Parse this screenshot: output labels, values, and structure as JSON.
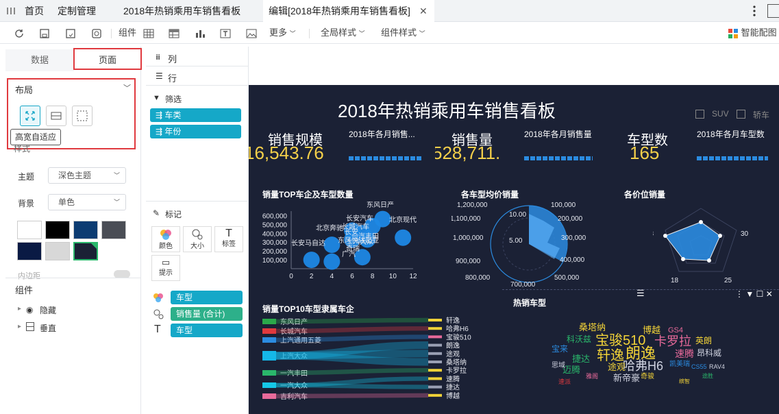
{
  "tabs": {
    "menu_icon": "grid-menu-icon",
    "home": "首页",
    "custom": "定制管理",
    "board": "2018年热销乘用车销售看板",
    "edit": "编辑[2018年热销乘用车销售看板]"
  },
  "toolbar": {
    "component": "组件",
    "more": "更多",
    "global_style": "全局样式",
    "component_style": "组件样式",
    "smart_chart": "智能配图"
  },
  "left": {
    "tab_data": "数据",
    "tab_page": "页面",
    "layout": "布局",
    "tooltip": "高宽自适应",
    "style": "样式",
    "theme_label": "主题",
    "theme_value": "深色主题",
    "bg_label": "背景",
    "bg_value": "单色",
    "inner_margin": "内边距",
    "components": "组件",
    "hidden": "隐藏",
    "vertical": "垂直",
    "swatches": [
      "#ffffff",
      "#000000",
      "#0c3c72",
      "#4a4d55",
      "#0a1a44",
      "#d8d8d8",
      "#1b2135"
    ]
  },
  "mid": {
    "col": "列",
    "row": "行",
    "filter": "筛选",
    "filter_items": [
      "车类",
      "年份"
    ],
    "mark": "标记",
    "mark_buttons": [
      "颜色",
      "大小",
      "标签",
      "提示"
    ],
    "mark_fields": [
      "车型",
      "销售量 (合计)",
      "车型"
    ]
  },
  "dash": {
    "title": "2018年热销乘用车销售看板",
    "legend": [
      "SUV",
      "轿车"
    ],
    "kpis": [
      {
        "title": "销售规模",
        "value": "16,543.76"
      },
      {
        "title": "销售量",
        "value": "528,711."
      },
      {
        "title": "车型数",
        "value": "165"
      }
    ],
    "minis": [
      "2018年各月销售...",
      "2018年各月销售量",
      "2018年各月车型数"
    ],
    "scatter_title": "销量TOP车企及车型数量",
    "polar_title": "各车型均价销量",
    "radar_title": "各价位销量",
    "sankey_title": "销量TOP10车型隶属车企",
    "cloud_title": "热销车型",
    "sankey_left": [
      "东风日产",
      "长城汽车",
      "上汽通用五菱",
      "上汽大众",
      "一汽丰田",
      "一汽大众",
      "吉利汽车"
    ],
    "sankey_right": [
      "轩逸",
      "哈弗H6",
      "宝骏510",
      "朗逸",
      "途观",
      "桑塔纳",
      "卡罗拉",
      "速腾",
      "捷达",
      "博越"
    ],
    "scatter_labels": [
      "东风日产",
      "长安汽车",
      "北京现代",
      "北京奔驰",
      "长安马自达",
      "长城汽车",
      "一汽丰田",
      "上汽大众",
      "长安",
      "奇瑞",
      "广汽",
      "东风悦达起亚"
    ],
    "cloud_words": [
      "宝骏510",
      "朗逸",
      "轩逸",
      "哈弗H6",
      "卡罗拉",
      "桑塔纳",
      "博越",
      "科沃兹",
      "速腾",
      "捷达",
      "途观",
      "迈腾",
      "新帝豪",
      "昂科威",
      "英朗",
      "宝来",
      "GS4",
      "奇骏",
      "凯美瑞",
      "雅阁",
      "思域",
      "速派",
      "CS55",
      "RAV4",
      "途胜",
      "缤智"
    ],
    "radar_labels": [
      "13",
      "30",
      "25",
      "18"
    ],
    "polar_labels": [
      "1,200,000",
      "1,100,000",
      "1,000,000",
      "900,000",
      "800,000",
      "100,000",
      "200,000",
      "300,000",
      "400,000",
      "500,000",
      "10.00",
      "5.00",
      "700,000"
    ]
  },
  "chart_data": [
    {
      "type": "scatter",
      "title": "销量TOP车企及车型数量",
      "xlim": [
        0,
        12
      ],
      "ylim": [
        0,
        650000
      ],
      "x_ticks": [
        "0",
        "2",
        "4",
        "6",
        "8",
        "10",
        "12"
      ],
      "y_ticks": [
        "100,000",
        "200,000",
        "300,000",
        "400,000",
        "500,000",
        "600,000"
      ],
      "points": [
        {
          "x": 2,
          "y": 100000
        },
        {
          "x": 4,
          "y": 80000
        },
        {
          "x": 4,
          "y": 270000
        },
        {
          "x": 6,
          "y": 330000
        },
        {
          "x": 6,
          "y": 430000
        },
        {
          "x": 7,
          "y": 130000
        },
        {
          "x": 7,
          "y": 400000
        },
        {
          "x": 7.5,
          "y": 330000
        },
        {
          "x": 8,
          "y": 480000
        },
        {
          "x": 9,
          "y": 560000
        },
        {
          "x": 11,
          "y": 350000
        }
      ]
    },
    {
      "type": "radar",
      "title": "各价位销量",
      "axes": [
        "13",
        "30",
        "25",
        "18"
      ],
      "values": [
        0.4,
        0.55,
        0.45,
        0.5
      ]
    }
  ]
}
